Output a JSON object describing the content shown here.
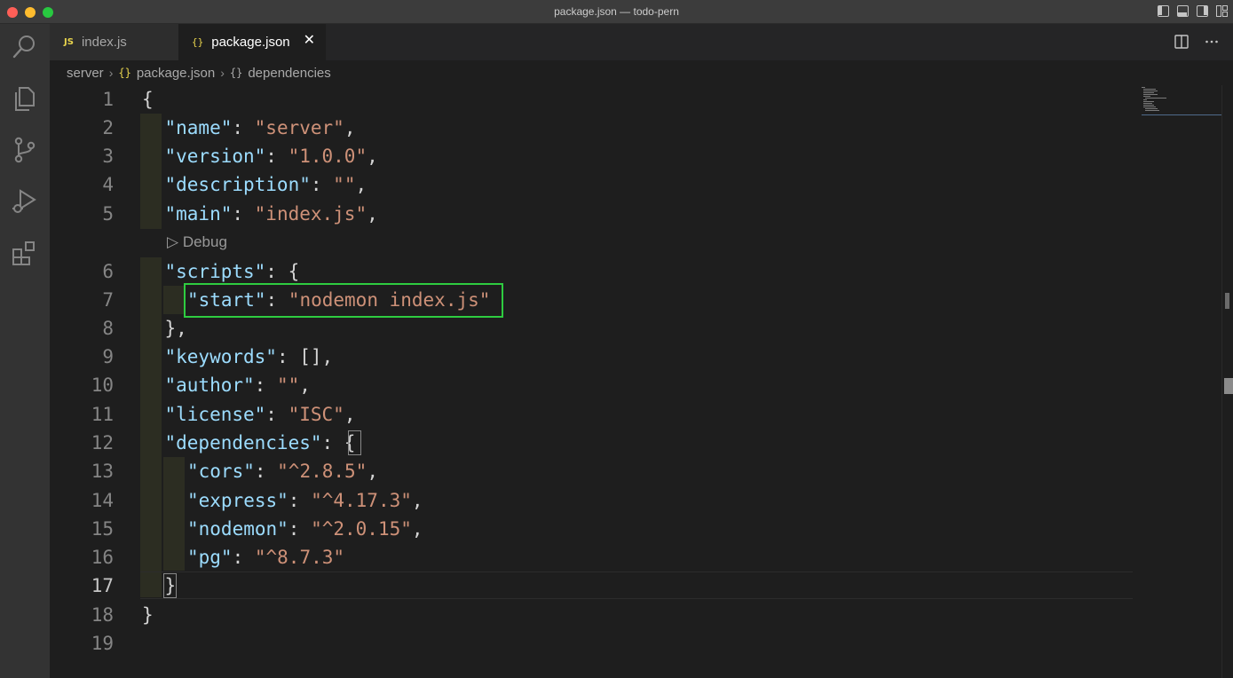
{
  "window": {
    "title": "package.json — todo-pern",
    "traffic_colors": [
      "#ff5f57",
      "#febc2e",
      "#28c840"
    ]
  },
  "activity_bar": {
    "icons": [
      "search-icon",
      "explorer-icon",
      "source-control-icon",
      "run-debug-icon",
      "extensions-icon"
    ]
  },
  "tabs": [
    {
      "icon": "JS",
      "label": "index.js",
      "active": false
    },
    {
      "icon": "{}",
      "label": "package.json",
      "active": true,
      "close": "✕"
    }
  ],
  "breadcrumbs": [
    {
      "label": "server",
      "icon": ""
    },
    {
      "label": "package.json",
      "icon": "{}"
    },
    {
      "label": "dependencies",
      "icon": "{}"
    }
  ],
  "codelens": {
    "icon": "▷",
    "label": "Debug"
  },
  "line_numbers": [
    "1",
    "2",
    "3",
    "4",
    "5",
    "6",
    "7",
    "8",
    "9",
    "10",
    "11",
    "12",
    "13",
    "14",
    "15",
    "16",
    "17",
    "18",
    "19"
  ],
  "code_lines": [
    "{",
    "\"name\": \"server\",",
    "\"version\": \"1.0.0\",",
    "\"description\": \"\",",
    "\"main\": \"index.js\",",
    "\"scripts\": {",
    "\"start\": \"nodemon index.js\"",
    "},",
    "\"keywords\": [],",
    "\"author\": \"\",",
    "\"license\": \"ISC\",",
    "\"dependencies\": {",
    "\"cors\": \"^2.8.5\",",
    "\"express\": \"^4.17.3\",",
    "\"nodemon\": \"^2.0.15\",",
    "\"pg\": \"^8.7.3\"",
    "}",
    "}",
    ""
  ],
  "active_line": "17",
  "colors": {
    "key": "#9cdcfe",
    "string": "#ce9178",
    "punctuation": "#d4d4d4",
    "highlight_box": "#2ecc40"
  }
}
